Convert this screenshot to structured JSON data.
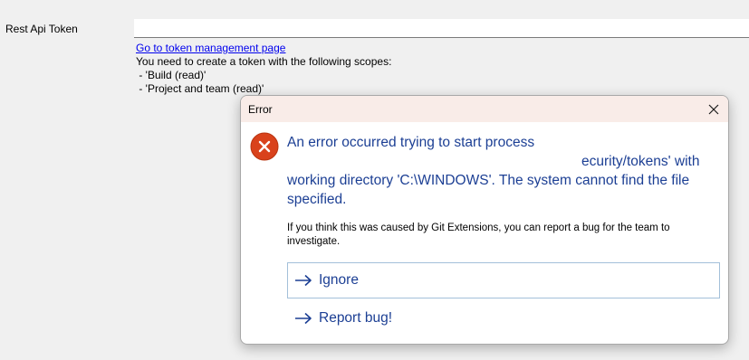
{
  "settings": {
    "field_label": "Rest Api Token",
    "token_value": "",
    "link_text": "Go to token management page",
    "scopes_intro": "You need to create a token with the following scopes:",
    "scopes": [
      " - 'Build (read)'",
      " - 'Project and team (read)'"
    ]
  },
  "dialog": {
    "title": "Error",
    "main_instruction": {
      "line1": "An error occurred trying to start process",
      "line2": "ecurity/tokens' with",
      "line3": "working directory 'C:\\WINDOWS'. The system cannot find the file specified."
    },
    "content": "If you think this was caused by Git Extensions, you can report a bug for the team to investigate.",
    "commands": [
      {
        "label": "Ignore"
      },
      {
        "label": "Report bug!"
      }
    ],
    "colors": {
      "title_bar": "#f9ece8",
      "instruction_text": "#1c3f94",
      "error_icon": "#d9421c",
      "focus_border": "#a3c0d9"
    }
  }
}
